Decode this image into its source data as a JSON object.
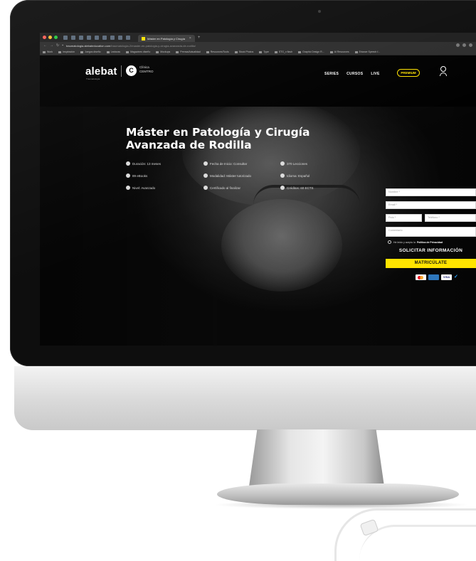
{
  "browser": {
    "tab_title": "Máster en Patología y Cirugía",
    "url_host": "traumatologia.alebateducation.com",
    "url_path": "/traumatologia-2/master-en-patologia-y-cirugia-avanzada-de-rodilla/",
    "bookmarks": [
      "Work",
      "Inspiración",
      "Juegos diseño",
      "Lecturas",
      "Magazines diseño",
      "Mockups",
      "Prensa/Actualidad",
      "Resources/Tools",
      "Stock Photos",
      "Type",
      "STG_x flash",
      "Graphic Design R...",
      "AI Resources",
      "Eriance Speech f..."
    ]
  },
  "header": {
    "logo": "alebat",
    "logo_sub": "Traumatología",
    "badge_letter": "C",
    "clinic_line1": "Clínica",
    "clinic_line2": "CEMTRO",
    "menu": [
      "SERIES",
      "CURSOS",
      "LIVE"
    ],
    "premium_label": "PREMIUM"
  },
  "hero": {
    "title_line1": "Máster en Patología y Cirugía",
    "title_line2": "Avanzada de Rodilla",
    "facts": [
      {
        "icon": "clock-icon",
        "text": "Duración: 13 meses"
      },
      {
        "icon": "calendar-icon",
        "text": "Fecha de Inicio: Consultar"
      },
      {
        "icon": "play-icon",
        "text": "370 Lecciones"
      },
      {
        "icon": "book-icon",
        "text": "89 eBooks"
      },
      {
        "icon": "tutor-icon",
        "text": "Modalidad: Máster tutorizado"
      },
      {
        "icon": "language-icon",
        "text": "Idioma: Español"
      },
      {
        "icon": "level-icon",
        "text": "Nivel: Avanzado"
      },
      {
        "icon": "certificate-icon",
        "text": "Certificado al finalizar"
      },
      {
        "icon": "credits-icon",
        "text": "Créditos: 60 ECTS"
      }
    ]
  },
  "form": {
    "name_placeholder": "Nombre *",
    "email_placeholder": "Email *",
    "country_placeholder": "País *",
    "phone_placeholder": "Teléfono *",
    "comment_placeholder": "Comentario",
    "privacy_text": "He leído y acepto la",
    "privacy_link": "Política de Privacidad",
    "info_button": "SOLICITAR INFORMACIÓN",
    "enroll_button": "MATRICÚLATE",
    "payments": [
      "mastercard-icon",
      "amex-icon",
      "VISA",
      "paypal-icon"
    ]
  },
  "colors": {
    "accent": "#ffe300",
    "background": "#000000"
  }
}
